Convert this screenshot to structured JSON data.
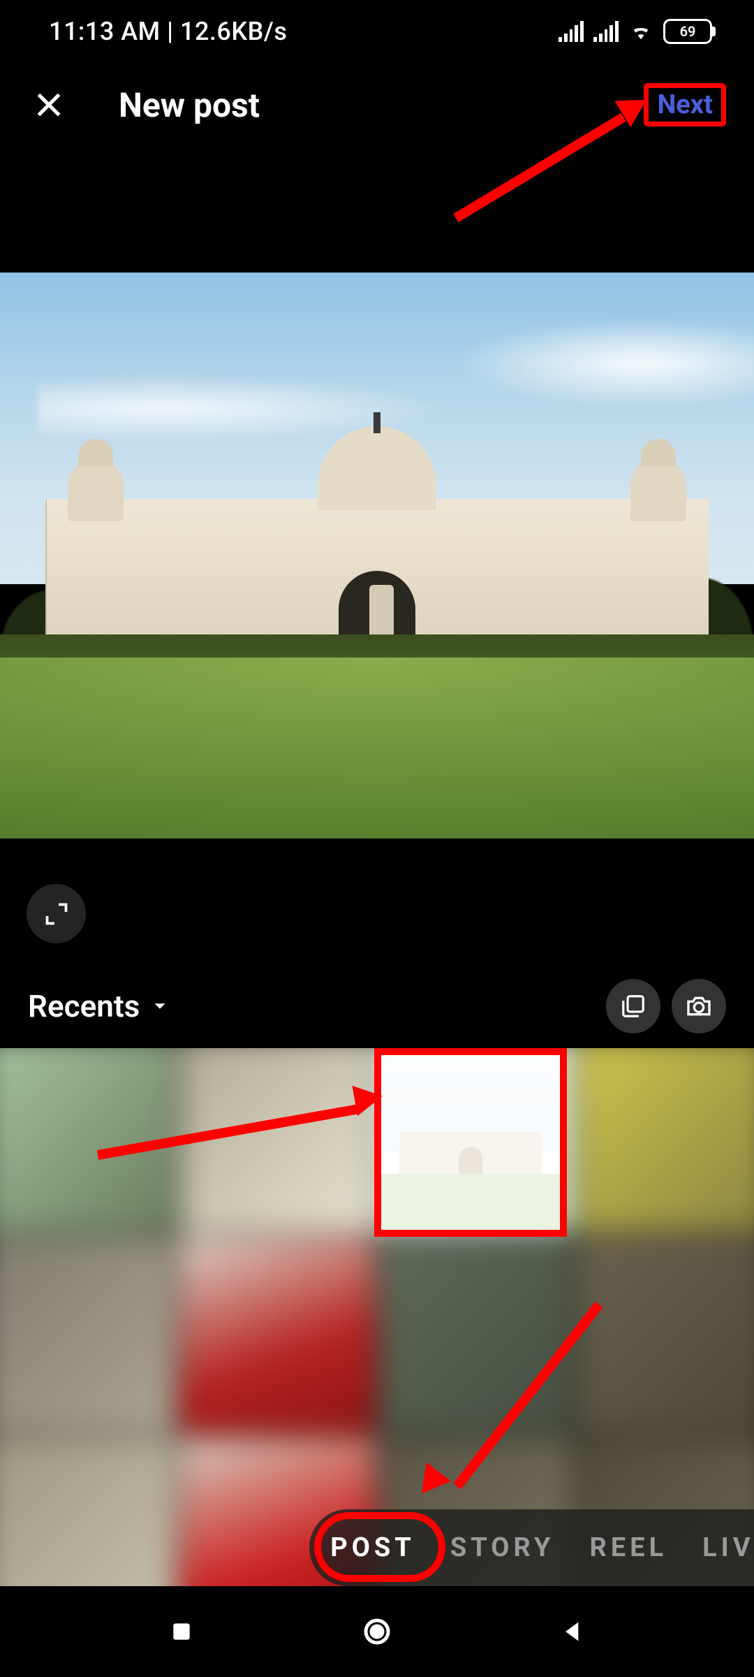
{
  "status": {
    "time_and_speed": "11:13 AM | 12.6KB/s",
    "battery_percent": "69"
  },
  "header": {
    "title": "New post",
    "next_label": "Next"
  },
  "album": {
    "name": "Recents"
  },
  "modes": {
    "items": [
      "POST",
      "STORY",
      "REEL",
      "LIVE"
    ],
    "active_index": 0
  },
  "annotations": {
    "highlight_next": true,
    "highlight_selected_thumb": true,
    "highlight_post_mode": true
  }
}
